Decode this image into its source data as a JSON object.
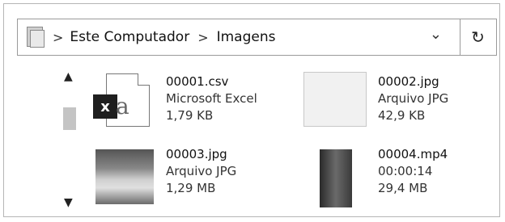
{
  "address_bar": {
    "breadcrumb": [
      "Este Computador",
      "Imagens"
    ],
    "separator": ">",
    "dropdown_icon": "chevron-down-icon",
    "refresh_icon": "refresh-icon"
  },
  "files": [
    {
      "name": "00001.csv",
      "type": "Microsoft Excel",
      "info": "1,79 KB",
      "icon": "excel-file-icon"
    },
    {
      "name": "00002.jpg",
      "type": "Arquivo JPG",
      "info": "42,9 KB",
      "icon": "image-thumbnail"
    },
    {
      "name": "00003.jpg",
      "type": "Arquivo JPG",
      "info": "1,29 MB",
      "icon": "image-thumbnail"
    },
    {
      "name": "00004.mp4",
      "type": "00:00:14",
      "info": "29,4 MB",
      "icon": "video-thumbnail"
    }
  ],
  "scrollbar": {
    "up_icon": "scroll-up-icon",
    "down_icon": "scroll-down-icon"
  }
}
